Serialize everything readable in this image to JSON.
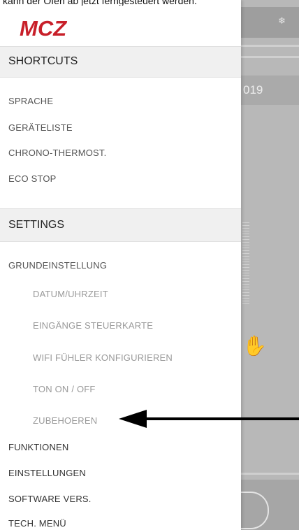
{
  "caption": "kann der Ofen ab jetzt ferngesteuert werden.",
  "brand": {
    "logo_text": "MCZ",
    "color": "#c8202a"
  },
  "background": {
    "year_fragment": "019",
    "snow_icon": "snowflake-icon",
    "hand_icon": "hand-icon"
  },
  "drawer": {
    "shortcuts_title": "SHORTCUTS",
    "shortcuts": [
      "SPRACHE",
      "GERÄTELISTE",
      "CHRONO-THERMOST.",
      "ECO STOP"
    ],
    "settings_title": "SETTINGS",
    "grundeinstellung": "GRUNDEINSTELLUNG",
    "sub_items": [
      "DATUM/UHRZEIT",
      "EINGÄNGE STEUERKARTE",
      "WIFI FÜHLER KONFIGURIEREN",
      "TON ON / OFF",
      "ZUBEHOEREN"
    ],
    "items": [
      "FUNKTIONEN",
      "EINSTELLUNGEN",
      "SOFTWARE VERS.",
      "TECH. MENÜ"
    ]
  }
}
